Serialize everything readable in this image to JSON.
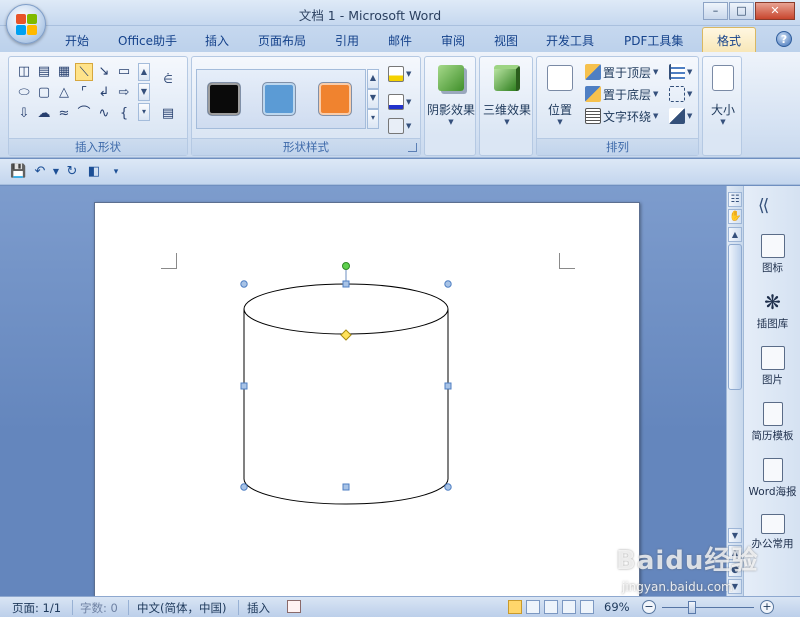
{
  "window": {
    "title": "文档 1 - Microsoft Word"
  },
  "tabs": [
    {
      "label": "开始"
    },
    {
      "label": "Office助手"
    },
    {
      "label": "插入"
    },
    {
      "label": "页面布局"
    },
    {
      "label": "引用"
    },
    {
      "label": "邮件"
    },
    {
      "label": "审阅"
    },
    {
      "label": "视图"
    },
    {
      "label": "开发工具"
    },
    {
      "label": "PDF工具集"
    },
    {
      "label": "格式",
      "active": true
    }
  ],
  "ribbon": {
    "groups": {
      "insert_shapes": "插入形状",
      "shape_styles": "形状样式",
      "arrange": "排列"
    },
    "style_swatches": [
      "#0a0a0a",
      "#5b9bd5",
      "#f0832f"
    ],
    "shadow_effects": "阴影效果",
    "threed_effects": "三维效果",
    "position": "位置",
    "bring_to_front": "置于顶层",
    "send_to_back": "置于底层",
    "text_wrapping": "文字环绕",
    "size": "大小"
  },
  "sidepanel": {
    "items": [
      {
        "label": "图标"
      },
      {
        "label": "插图库"
      },
      {
        "label": "图片"
      },
      {
        "label": "简历模板"
      },
      {
        "label": "Word海报"
      },
      {
        "label": "办公常用"
      }
    ]
  },
  "statusbar": {
    "page": "页面: 1/1",
    "words": "字数: 0",
    "language": "中文(简体，中国)",
    "mode": "插入",
    "zoom": "69%",
    "zoom_level": 0.69
  },
  "watermark": {
    "brand": "Baidu经验",
    "url": "jingyan.baidu.com"
  },
  "colors": {
    "accent": "#15428b",
    "active_tab": "#f8e7b8",
    "selection_handle": "#4f7fc3"
  }
}
